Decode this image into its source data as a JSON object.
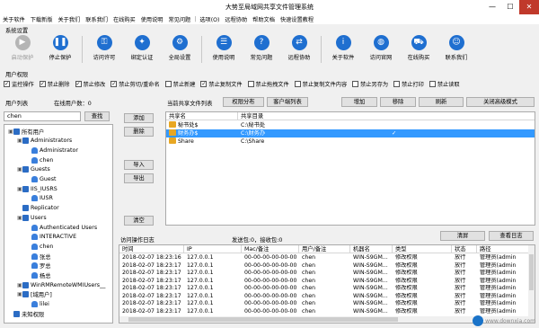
{
  "window": {
    "title": "大势至局域网共享文件管理系统",
    "minimize": "—",
    "maximize": "☐",
    "close": "✕"
  },
  "menu": [
    "关于软件",
    "下载新版",
    "关于我们",
    "联系我们",
    "在线购买",
    "使用说明",
    "常见问题",
    "|",
    "选项(O)",
    "远程协助",
    "帮助文档",
    "快速设置教程"
  ],
  "system_settings_label": "系统设置",
  "toolbar": [
    {
      "label": "启动保护",
      "icon": "play-icon",
      "glyph": "▶",
      "disabled": true
    },
    {
      "label": "停止保护",
      "icon": "pause-icon",
      "glyph": "❚❚",
      "disabled": false
    },
    {
      "label": "访问许可",
      "icon": "key-icon",
      "glyph": "⚿",
      "disabled": false
    },
    {
      "label": "绑定认证",
      "icon": "lock-icon",
      "glyph": "✦",
      "disabled": false
    },
    {
      "label": "全局设置",
      "icon": "gear-icon",
      "glyph": "⚙",
      "disabled": false
    },
    {
      "label": "使用说明",
      "icon": "book-icon",
      "glyph": "☰",
      "disabled": false
    },
    {
      "label": "常见问题",
      "icon": "question-icon",
      "glyph": "?",
      "disabled": false
    },
    {
      "label": "远程协助",
      "icon": "remote-icon",
      "glyph": "⇄",
      "disabled": false
    },
    {
      "label": "关于软件",
      "icon": "info-icon",
      "glyph": "i",
      "disabled": false
    },
    {
      "label": "访问官网",
      "icon": "globe-icon",
      "glyph": "◍",
      "disabled": false
    },
    {
      "label": "在线购买",
      "icon": "cart-icon",
      "glyph": "⛟",
      "disabled": false
    },
    {
      "label": "联系我们",
      "icon": "people-icon",
      "glyph": "☺",
      "disabled": false
    }
  ],
  "user_perm_label": "用户权限",
  "permissions": [
    {
      "label": "监控操作",
      "checked": true
    },
    {
      "label": "禁止删除",
      "checked": true
    },
    {
      "label": "禁止修改",
      "checked": true
    },
    {
      "label": "禁止剪切/重命名",
      "checked": true
    },
    {
      "label": "禁止新建",
      "checked": false
    },
    {
      "label": "禁止复制文件",
      "checked": true
    },
    {
      "label": "禁止拖拽文件",
      "checked": false
    },
    {
      "label": "禁止复制文件内容",
      "checked": false
    },
    {
      "label": "禁止另存为",
      "checked": false
    },
    {
      "label": "禁止打印",
      "checked": false
    },
    {
      "label": "禁止读取",
      "checked": false
    }
  ],
  "user_list": {
    "label": "用户列表",
    "online": "在线用户数：0",
    "search_value": "chen",
    "search_button": "查找"
  },
  "user_tree": [
    {
      "text": "所有用户",
      "level": 0,
      "icon": "group",
      "exp": "▣"
    },
    {
      "text": "Administrators",
      "level": 1,
      "icon": "group",
      "exp": "▣"
    },
    {
      "text": "Administrator",
      "level": 2,
      "icon": "user",
      "exp": ""
    },
    {
      "text": "chen",
      "level": 2,
      "icon": "user",
      "exp": ""
    },
    {
      "text": "Guests",
      "level": 1,
      "icon": "group",
      "exp": "▣"
    },
    {
      "text": "Guest",
      "level": 2,
      "icon": "user",
      "exp": ""
    },
    {
      "text": "IIS_IUSRS",
      "level": 1,
      "icon": "group",
      "exp": "▣"
    },
    {
      "text": "IUSR",
      "level": 2,
      "icon": "user",
      "exp": ""
    },
    {
      "text": "Replicator",
      "level": 1,
      "icon": "group",
      "exp": ""
    },
    {
      "text": "Users",
      "level": 1,
      "icon": "group",
      "exp": "▣"
    },
    {
      "text": "Authenticated Users",
      "level": 2,
      "icon": "user",
      "exp": ""
    },
    {
      "text": "INTERACTIVE",
      "level": 2,
      "icon": "user",
      "exp": ""
    },
    {
      "text": "chen",
      "level": 2,
      "icon": "user",
      "exp": ""
    },
    {
      "text": "张总",
      "level": 2,
      "icon": "user",
      "exp": ""
    },
    {
      "text": "罗总",
      "level": 2,
      "icon": "user",
      "exp": ""
    },
    {
      "text": "杨总",
      "level": 2,
      "icon": "user",
      "exp": ""
    },
    {
      "text": "WinRMRemoteWMIUsers__",
      "level": 1,
      "icon": "group",
      "exp": "▣"
    },
    {
      "text": "[域用户]",
      "level": 1,
      "icon": "group",
      "exp": "▣"
    },
    {
      "text": "lilei",
      "level": 2,
      "icon": "user",
      "exp": ""
    },
    {
      "text": "未知权限",
      "level": 0,
      "icon": "group",
      "exp": ""
    }
  ],
  "side_buttons": {
    "add": "添加",
    "delete": "删除",
    "import": "导入",
    "export": "导出",
    "clear": "清空"
  },
  "share": {
    "label": "当前共享文件列表",
    "perm_assign": "权限分布",
    "client_list": "客户端列表",
    "add": "增加",
    "remove": "移除",
    "refresh": "刷新",
    "close_adv": "关闭高级模式",
    "columns": [
      "共享名",
      "共享目录"
    ],
    "rows": [
      {
        "name": "秘书处$",
        "path": "C:\\秘书处",
        "check": "",
        "selected": false
      },
      {
        "name": "财务办$",
        "path": "C:\\财务办",
        "check": "✓",
        "selected": true
      },
      {
        "name": "Share",
        "path": "C:\\Share",
        "check": "",
        "selected": false
      }
    ]
  },
  "log": {
    "label": "访问操作日志",
    "status": "发送包:0，接收包:0",
    "clear": "清屏",
    "view": "查看日志",
    "columns": [
      "时间",
      "IP",
      "Mac/备注",
      "用户/备注",
      "机器名",
      "类型",
      "状态",
      "路径"
    ],
    "rows": [
      [
        "2018-02-07 18:23:16",
        "127.0.0.1",
        "00-00-00-00-00-00",
        "chen",
        "WIN-S9GM...",
        "修改权限",
        "放行",
        "管理员(admin"
      ],
      [
        "2018-02-07 18:23:17",
        "127.0.0.1",
        "00-00-00-00-00-00",
        "chen",
        "WIN-S9GM...",
        "修改权限",
        "放行",
        "管理员(admin"
      ],
      [
        "2018-02-07 18:23:17",
        "127.0.0.1",
        "00-00-00-00-00-00",
        "chen",
        "WIN-S9GM...",
        "修改权限",
        "放行",
        "管理员(admin"
      ],
      [
        "2018-02-07 18:23:17",
        "127.0.0.1",
        "00-00-00-00-00-00",
        "chen",
        "WIN-S9GM...",
        "修改权限",
        "放行",
        "管理员(admin"
      ],
      [
        "2018-02-07 18:23:17",
        "127.0.0.1",
        "00-00-00-00-00-00",
        "chen",
        "WIN-S9GM...",
        "修改权限",
        "放行",
        "管理员(admin"
      ],
      [
        "2018-02-07 18:23:17",
        "127.0.0.1",
        "00-00-00-00-00-00",
        "chen",
        "WIN-S9GM...",
        "修改权限",
        "放行",
        "管理员(admin"
      ],
      [
        "2018-02-07 18:23:17",
        "127.0.0.1",
        "00-00-00-00-00-00",
        "chen",
        "WIN-S9GM...",
        "修改权限",
        "放行",
        "管理员(admin"
      ],
      [
        "2018-02-07 18:23:17",
        "127.0.0.1",
        "00-00-00-00-00-00",
        "chen",
        "WIN-S9GM...",
        "修改权限",
        "放行",
        "管理员(admin"
      ]
    ]
  },
  "watermark": "www.downxia.com"
}
